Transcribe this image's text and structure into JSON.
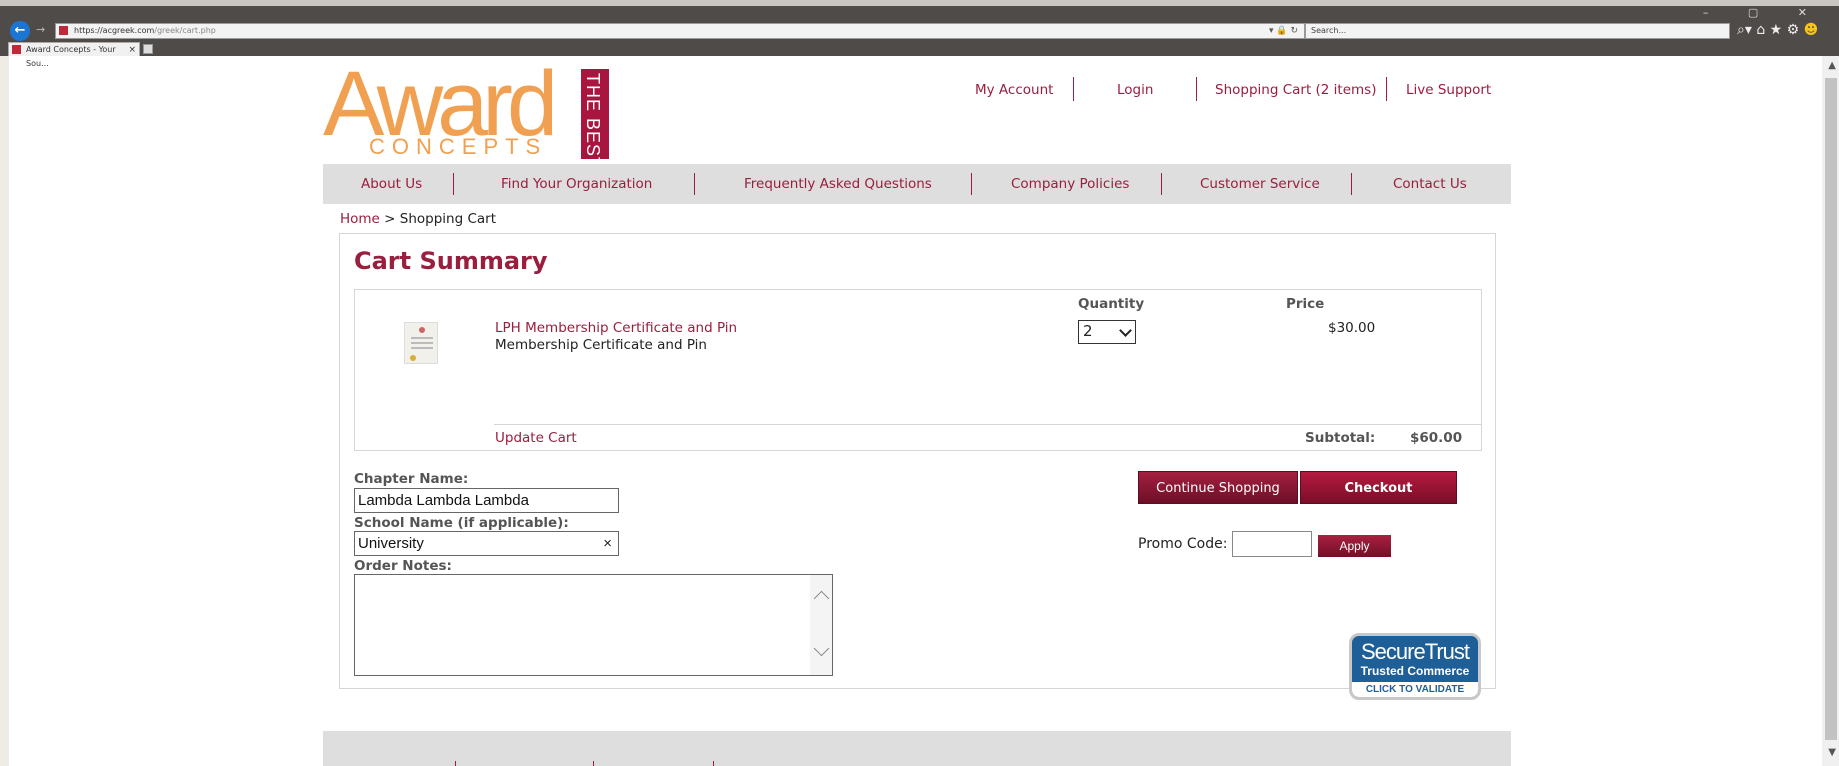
{
  "browser": {
    "window_controls": "–  ▢  ✕",
    "url_main": "https://acgreek.com",
    "url_path": "/greek/cart.php",
    "address_controls": "▾ 🔒 ↻",
    "search_placeholder": "Search...",
    "toolbar_icons": "⌕▾ ⌂ ★ ⚙",
    "tab_title": "Award Concepts - Your Sou...",
    "tab_close": "×"
  },
  "logo": {
    "main": "Award",
    "sub": "CONCEPTS",
    "badge": "THE BEST"
  },
  "top_links": [
    "My Account",
    "Login",
    "Shopping Cart (2 items)",
    "Live Support"
  ],
  "nav": [
    "About Us",
    "Find Your Organization",
    "Frequently Asked Questions",
    "Company Policies",
    "Customer Service",
    "Contact Us"
  ],
  "breadcrumb": {
    "home": "Home",
    "separator": " > ",
    "current": "Shopping Cart"
  },
  "cart": {
    "title": "Cart Summary",
    "headers": {
      "quantity": "Quantity",
      "price": "Price"
    },
    "item": {
      "name": "LPH Membership Certificate and Pin",
      "description": "Membership Certificate and Pin",
      "quantity": "2",
      "price": "$30.00"
    },
    "update_label": "Update Cart",
    "subtotal_label": "Subtotal:",
    "subtotal_value": "$60.00"
  },
  "form": {
    "chapter_label": "Chapter Name:",
    "chapter_value": "Lambda Lambda Lambda",
    "school_label": "School Name (if applicable):",
    "school_value": "University",
    "clear_icon": "×",
    "notes_label": "Order Notes:"
  },
  "actions": {
    "continue_label": "Continue Shopping",
    "checkout_label": "Checkout",
    "promo_label": "Promo Code:",
    "apply_label": "Apply"
  },
  "secure_badge": {
    "line1": "SecureTrust",
    "line2": "Trusted Commerce",
    "line3": "CLICK TO VALIDATE"
  },
  "colors": {
    "brand": "#9a1e3e",
    "logo_orange": "#f0a050",
    "nav_bg": "#dedede"
  }
}
